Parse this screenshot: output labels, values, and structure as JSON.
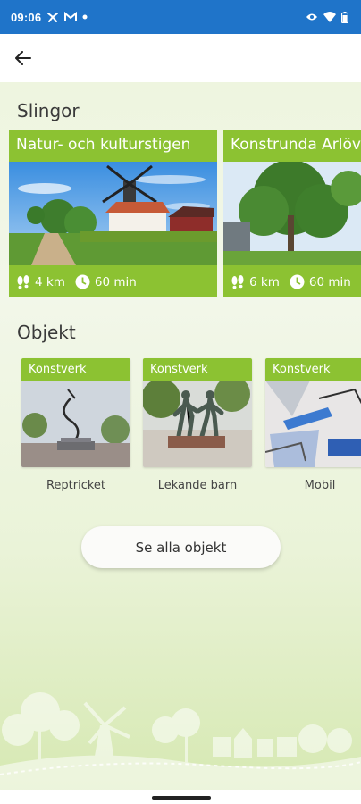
{
  "status_bar": {
    "time": "09:06",
    "left_icons": [
      "fan-icon",
      "gmail-icon",
      "dot-icon"
    ],
    "right_icons": [
      "eye-icon",
      "wifi-icon",
      "battery-icon"
    ],
    "bar_color": "#1f74c9"
  },
  "app_bar": {
    "back_icon": "arrow-left-icon"
  },
  "loops": {
    "title": "Slingor",
    "items": [
      {
        "name": "Natur- och kulturstigen",
        "distance": "4 km",
        "duration": "60 min"
      },
      {
        "name": "Konstrunda Arlöv",
        "distance": "6 km",
        "duration": "60 min"
      }
    ]
  },
  "objects": {
    "title": "Objekt",
    "items": [
      {
        "category": "Konstverk",
        "name": "Reptricket"
      },
      {
        "category": "Konstverk",
        "name": "Lekande barn"
      },
      {
        "category": "Konstverk",
        "name": "Mobil"
      }
    ],
    "see_all_label": "Se alla objekt"
  },
  "colors": {
    "accent_green": "#8cc232",
    "status_blue": "#1f74c9"
  }
}
